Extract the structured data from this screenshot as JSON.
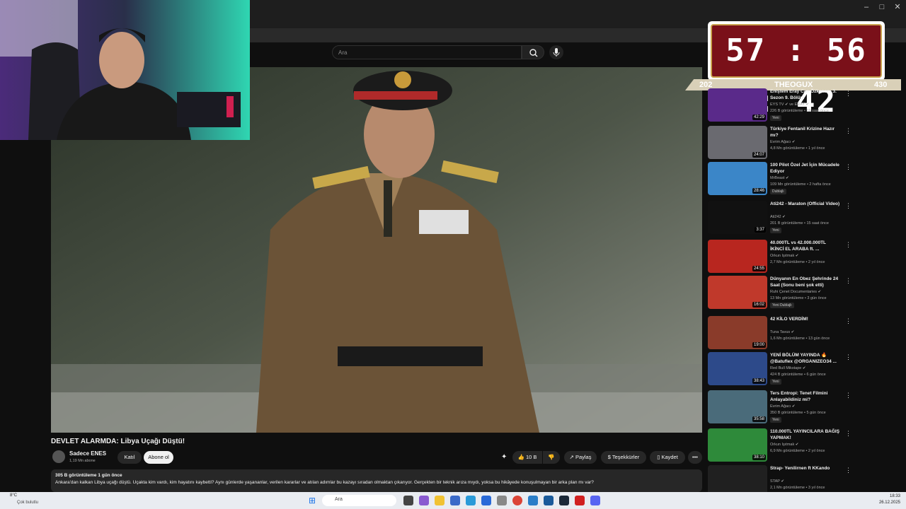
{
  "browser": {
    "minimize": "–",
    "maximize": "□",
    "close": "✕"
  },
  "search": {
    "placeholder": "Ara"
  },
  "timer": {
    "time": "57 : 56 : 42",
    "left_count": "202",
    "name": "THEOGUX",
    "right_count": "430"
  },
  "video": {
    "title": "DEVLET ALARMDA: Libya Uçağı Düştü!",
    "channel": "Sadece ENES",
    "subscribers": "1,19 Mn abone",
    "join_label": "Katıl",
    "subscribe_label": "Abone ol",
    "likes": "10 B",
    "share_label": "Paylaş",
    "thanks_label": "Teşekkürler",
    "save_label": "Kaydet",
    "stats": "305 B görüntüleme  1 gün önce",
    "description": "Ankara'dan kalkan Libya uçağı düştü. Uçakta kim vardı, kim hayatını kaybetti? Aynı günlerde yaşananlar, verilen kararlar ve atılan adımlar bu kazayı sıradan olmaktan çıkarıyor. Gerçekten bir teknik arıza mıydı, yoksa bu hikâyede konuşulmayan bir arka plan mı var?"
  },
  "recommendations": [
    {
      "title": "Eniştem Eray Can Özkenar - 3. Sezon 9. Bölüm",
      "channel": "EYS TV ✔ ve ERAY ✔",
      "meta": "226 B görüntüleme • 19 saat önce",
      "badge": "Yeni",
      "duration": "42:29",
      "color": "#5a2a8a"
    },
    {
      "title": "Türkiye Fentanil Krizine Hazır mı?",
      "channel": "Evrim Ağacı ✔",
      "meta": "4,8 Mn görüntüleme • 1 yıl önce",
      "badge": "",
      "duration": "24:07",
      "color": "#6a6a70"
    },
    {
      "title": "100 Pilot Özel Jet İçin Mücadele Ediyor",
      "channel": "MrBeast ✔",
      "meta": "109 Mn görüntüleme • 2 hafta önce",
      "badge": "Dublajlı",
      "duration": "28:46",
      "color": "#3b86c8"
    },
    {
      "title": "Ati242 - Maraton (Official Video)",
      "channel": "Ati242 ✔",
      "meta": "201 B görüntüleme • 15 saat önce",
      "badge": "Yeni",
      "duration": "3:37",
      "color": "#111111"
    },
    {
      "title": "40.000TL vs 42.000.000TL İKİNCİ EL ARABA ft. ...",
      "channel": "Orkun Işıtmak ✔",
      "meta": "2,7 Mn görüntüleme • 2 yıl önce",
      "badge": "",
      "duration": "24:55",
      "color": "#b8261f"
    },
    {
      "title": "Dünyanın En Obez Şehrinde 24 Saat (Sonu beni şok etti)",
      "channel": "Ruhi Çenet Documentaries ✔",
      "meta": "13 Mn görüntüleme • 3 gün önce",
      "badge": "Yeni  Dublajlı",
      "duration": "16:02",
      "color": "#c0392b"
    },
    {
      "title": "42 KİLO VERDİM!",
      "channel": "Tuna Tavus ✔",
      "meta": "1,6 Mn görüntüleme • 13 gün önce",
      "badge": "",
      "duration": "19:00",
      "color": "#8a3b2a"
    },
    {
      "title": "YENİ BÖLÜM YAYINDA 🔥 @Batuflex @ORGANIZEO34 ...",
      "channel": "Red Bull Mikstape ✔",
      "meta": "424 B görüntüleme • 6 gün önce",
      "badge": "Yeni",
      "duration": "38:43",
      "color": "#2d4a8a"
    },
    {
      "title": "Ters Entropi: Tenet Filmini Anlayabildiniz mi?",
      "channel": "Evrim Ağacı ✔",
      "meta": "350 B görüntüleme • 5 gün önce",
      "badge": "Yeni",
      "duration": "35:58",
      "color": "#4a6b7a"
    },
    {
      "title": "110.000TL YAYINCILARA BAĞIŞ YAPMAK!",
      "channel": "Orkun Işıtmak ✔",
      "meta": "6,9 Mn görüntüleme • 2 yıl önce",
      "badge": "",
      "duration": "38:10",
      "color": "#2e8a3a"
    },
    {
      "title": "Strap- Yenilirnen ft KKando",
      "channel": "STAP ✔",
      "meta": "2,1 Mn görüntüleme • 3 yıl önce",
      "badge": "",
      "duration": "",
      "color": "#202020"
    }
  ],
  "taskbar": {
    "weather_temp": "8°C",
    "weather_desc": "Çok bulutlu",
    "search_label": "Ara",
    "time": "18:33",
    "date": "26.12.2025"
  }
}
